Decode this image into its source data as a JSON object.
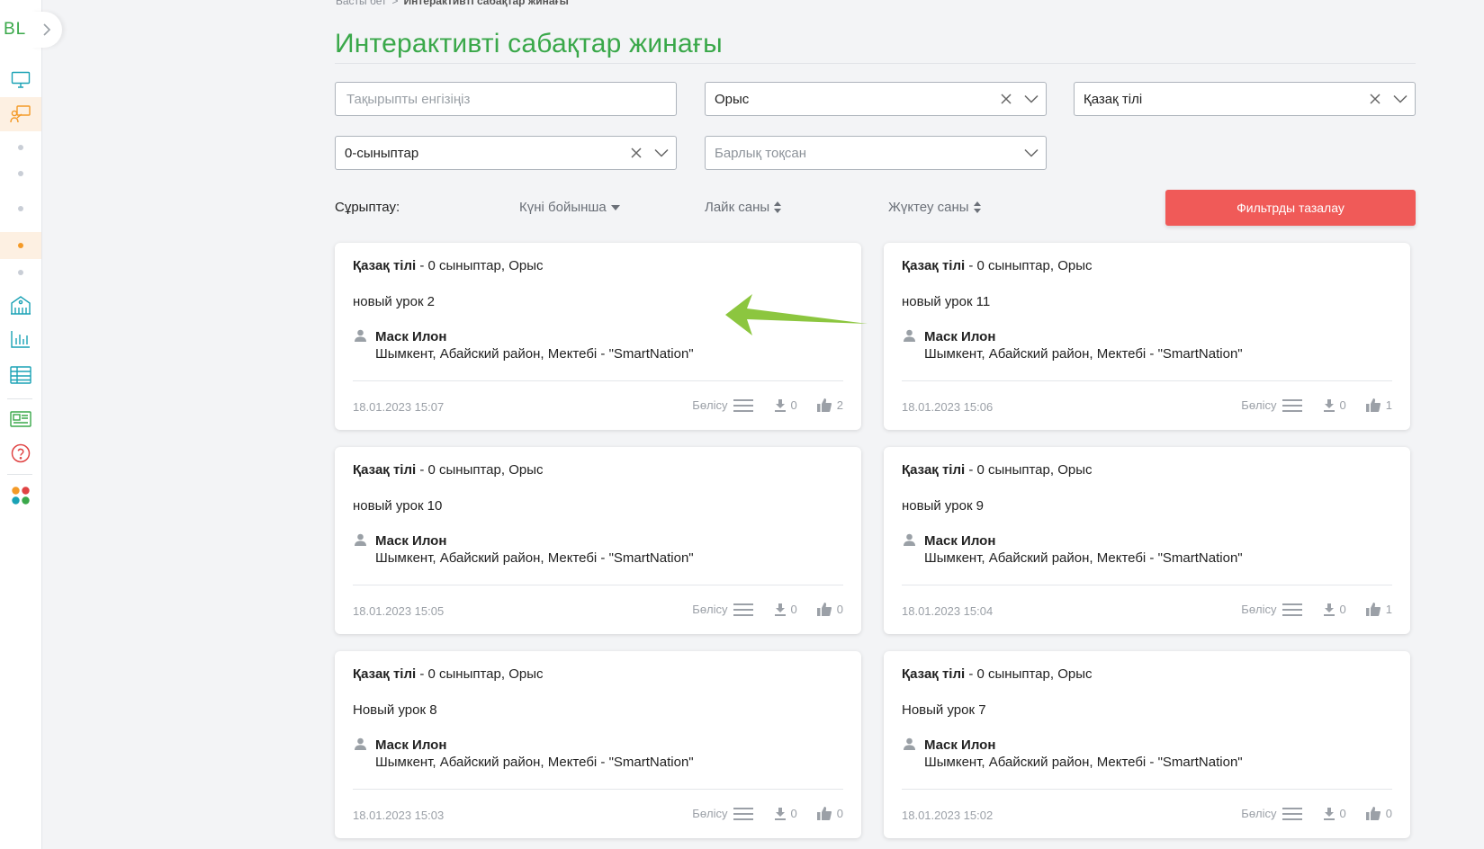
{
  "sidebar": {
    "logo": "BL",
    "colors": {
      "icon": "#1aa2b5",
      "active_icon": "#f49a27",
      "active_bg": "#fdf0e2"
    },
    "items": [
      {
        "name": "monitor-icon"
      },
      {
        "name": "teacher-board-icon",
        "active": true
      },
      {
        "name": "dot-1"
      },
      {
        "name": "dot-2"
      },
      {
        "name": "dot-3"
      },
      {
        "name": "dot-4",
        "active": true
      },
      {
        "name": "dot-5"
      },
      {
        "name": "institution-icon"
      },
      {
        "name": "chart-icon"
      },
      {
        "name": "table-icon"
      },
      {
        "name": "news-icon"
      },
      {
        "name": "help-icon"
      },
      {
        "name": "apps-icon"
      }
    ]
  },
  "breadcrumb": {
    "home": "Басты бет",
    "separator": ">",
    "current": "Интерактивті сабақтар жинағы"
  },
  "page": {
    "title": "Интерактивті сабақтар жинағы",
    "accent": "#3aa84a"
  },
  "filters": {
    "topic": {
      "placeholder": "Тақырыпты енгізіңіз",
      "value": ""
    },
    "language": {
      "value": "Орыс"
    },
    "subject": {
      "value": "Қазақ тілі"
    },
    "grade": {
      "value": "0-сыныптар"
    },
    "quarter": {
      "placeholder": "Барлық тоқсан"
    }
  },
  "sort": {
    "label": "Сұрыптау:",
    "by_date": "Күні бойынша",
    "by_likes": "Лайк саны",
    "by_downloads": "Жүктеу саны"
  },
  "clear_button": {
    "label": "Фильтрды тазалау",
    "color": "#f05a58"
  },
  "lessons": [
    {
      "subject": "Қазақ тілі",
      "meta": " - 0 сыныптар, Орыс",
      "title": "новый урок 2",
      "author": "Маск Илон",
      "school": "Шымкент, Абайский район, Мектебі - \"SmartNation\"",
      "date": "18.01.2023 15:07",
      "share": "Бөлісу",
      "downloads": "0",
      "likes": "2"
    },
    {
      "subject": "Қазақ тілі",
      "meta": " - 0 сыныптар, Орыс",
      "title": "новый урок 11",
      "author": "Маск Илон",
      "school": "Шымкент, Абайский район, Мектебі - \"SmartNation\"",
      "date": "18.01.2023 15:06",
      "share": "Бөлісу",
      "downloads": "0",
      "likes": "1"
    },
    {
      "subject": "Қазақ тілі",
      "meta": " - 0 сыныптар, Орыс",
      "title": "новый урок 10",
      "author": "Маск Илон",
      "school": "Шымкент, Абайский район, Мектебі - \"SmartNation\"",
      "date": "18.01.2023 15:05",
      "share": "Бөлісу",
      "downloads": "0",
      "likes": "0"
    },
    {
      "subject": "Қазақ тілі",
      "meta": " - 0 сыныптар, Орыс",
      "title": "новый урок 9",
      "author": "Маск Илон",
      "school": "Шымкент, Абайский район, Мектебі - \"SmartNation\"",
      "date": "18.01.2023 15:04",
      "share": "Бөлісу",
      "downloads": "0",
      "likes": "1"
    },
    {
      "subject": "Қазақ тілі",
      "meta": " - 0 сыныптар, Орыс",
      "title": "Новый урок 8",
      "author": "Маск Илон",
      "school": "Шымкент, Абайский район, Мектебі - \"SmartNation\"",
      "date": "18.01.2023 15:03",
      "share": "Бөлісу",
      "downloads": "0",
      "likes": "0"
    },
    {
      "subject": "Қазақ тілі",
      "meta": " - 0 сыныптар, Орыс",
      "title": "Новый урок 7",
      "author": "Маск Илон",
      "school": "Шымкент, Абайский район, Мектебі - \"SmartNation\"",
      "date": "18.01.2023 15:02",
      "share": "Бөлісу",
      "downloads": "0",
      "likes": "0"
    }
  ],
  "annotation": {
    "arrow_color": "#8cc63f"
  }
}
